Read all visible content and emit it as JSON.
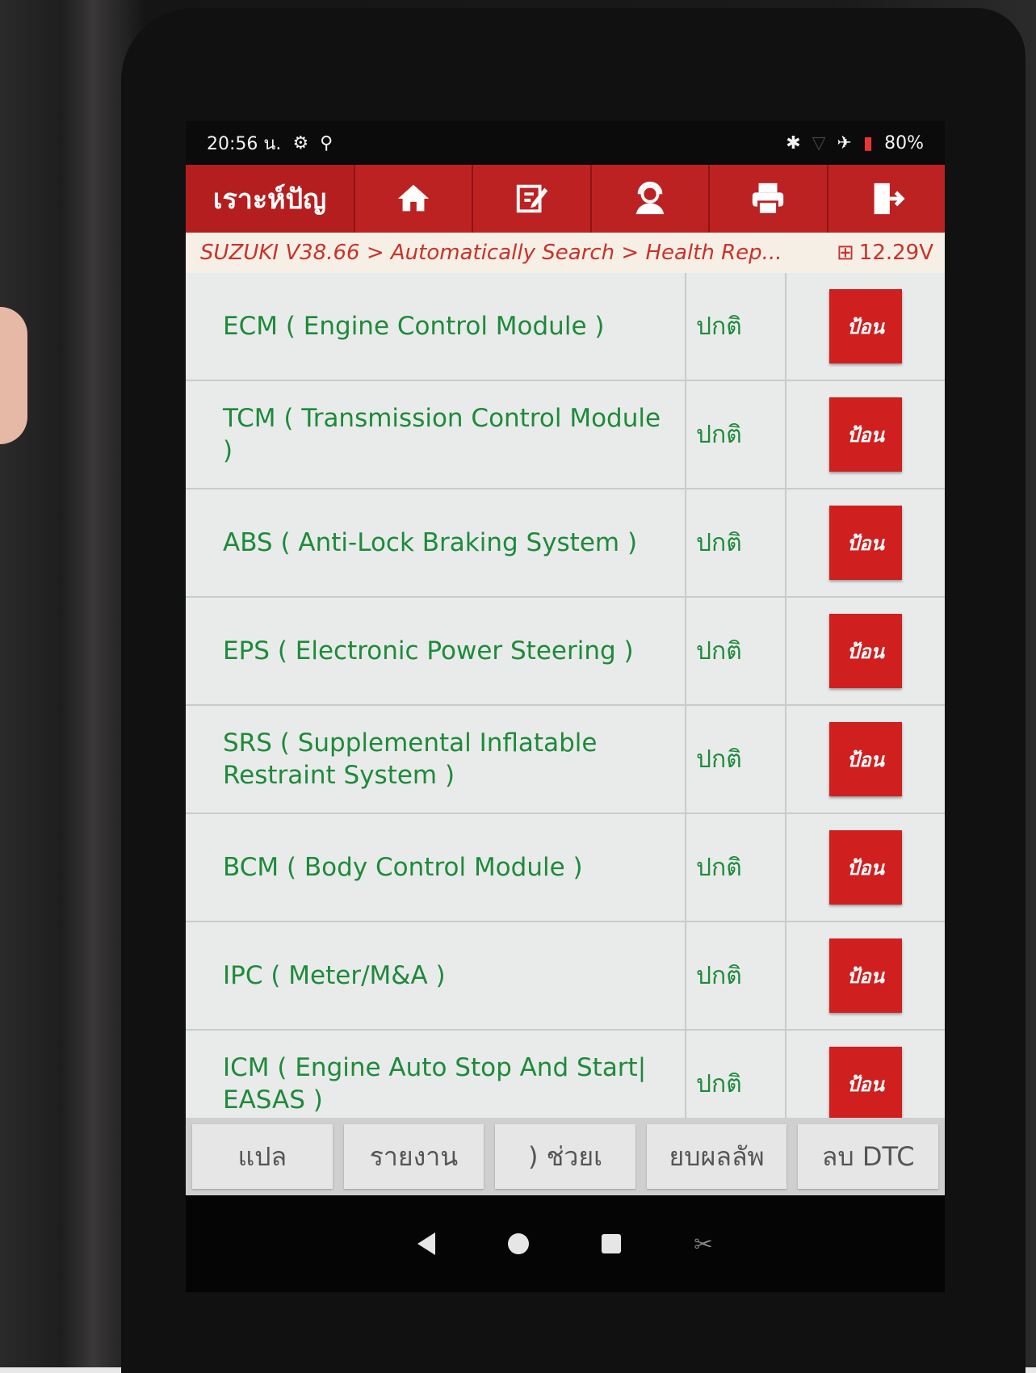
{
  "status_bar": {
    "time": "20:56 น.",
    "battery": "80%"
  },
  "topbar": {
    "brand": "เราะห์ปัญ",
    "icons": [
      "home-icon",
      "edit-icon",
      "user-support-icon",
      "print-icon",
      "exit-icon"
    ]
  },
  "breadcrumb": {
    "path": "SUZUKI V38.66 > Automatically Search > Health Rep...",
    "voltage": "12.29V"
  },
  "modules": [
    {
      "name": "ECM ( Engine Control Module )",
      "status": "ปกติ",
      "button": "ป้อน"
    },
    {
      "name": "TCM ( Transmission Control Module )",
      "status": "ปกติ",
      "button": "ป้อน"
    },
    {
      "name": "ABS ( Anti-Lock Braking System )",
      "status": "ปกติ",
      "button": "ป้อน"
    },
    {
      "name": "EPS ( Electronic Power Steering )",
      "status": "ปกติ",
      "button": "ป้อน"
    },
    {
      "name": "SRS ( Supplemental Inflatable Restraint System )",
      "status": "ปกติ",
      "button": "ป้อน"
    },
    {
      "name": "BCM ( Body Control Module )",
      "status": "ปกติ",
      "button": "ป้อน"
    },
    {
      "name": "IPC ( Meter/M&A )",
      "status": "ปกติ",
      "button": "ป้อน"
    },
    {
      "name": "ICM ( Engine Auto Stop And Start| EASAS )",
      "status": "ปกติ",
      "button": "ป้อน"
    }
  ],
  "actions": [
    "แปล",
    "รายงาน",
    ") ช่วยเ",
    "ยบผลลัพ",
    "ลบ DTC"
  ],
  "colors": {
    "header_red": "#b51e1e",
    "button_red": "#cf1f1f",
    "module_text_green": "#1e8a3a",
    "breadcrumb_red": "#c8322a"
  }
}
